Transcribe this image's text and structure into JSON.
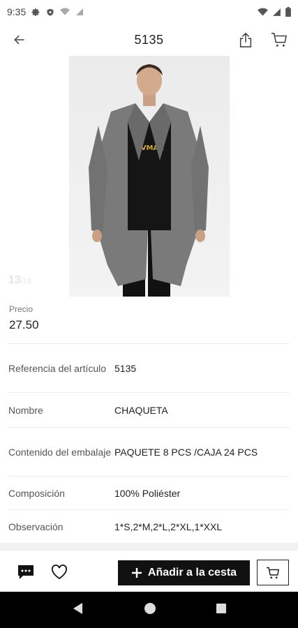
{
  "status_bar": {
    "time": "9:35"
  },
  "header": {
    "title": "5135"
  },
  "gallery": {
    "current": "13",
    "total": "/18"
  },
  "price": {
    "label": "Precio",
    "value": "27.50"
  },
  "details": [
    {
      "label": "Referencia del artículo",
      "value": "5135"
    },
    {
      "label": "Nombre",
      "value": "CHAQUETA"
    },
    {
      "label": "Contenido del embalaje",
      "value": "PAQUETE 8 PCS /CAJA 24 PCS"
    },
    {
      "label": "Composición",
      "value": "100% Poliéster"
    },
    {
      "label": "Observación",
      "value": "1*S,2*M,2*L,2*XL,1*XXL"
    }
  ],
  "actions": {
    "add_to_cart_label": "Añadir a la cesta"
  },
  "photo": {
    "shirt_print": "XVMAX"
  },
  "colors": {
    "primary_button": "#111111",
    "coat": "#7a7a7a",
    "background": "#ffffff"
  },
  "icons": [
    "settings-icon",
    "shield-icon",
    "wifi-icon",
    "signal-icon",
    "battery-icon",
    "back-arrow-icon",
    "share-icon",
    "cart-icon",
    "chat-icon",
    "heart-icon",
    "plus-icon",
    "nav-back-icon",
    "nav-home-icon",
    "nav-recents-icon"
  ]
}
